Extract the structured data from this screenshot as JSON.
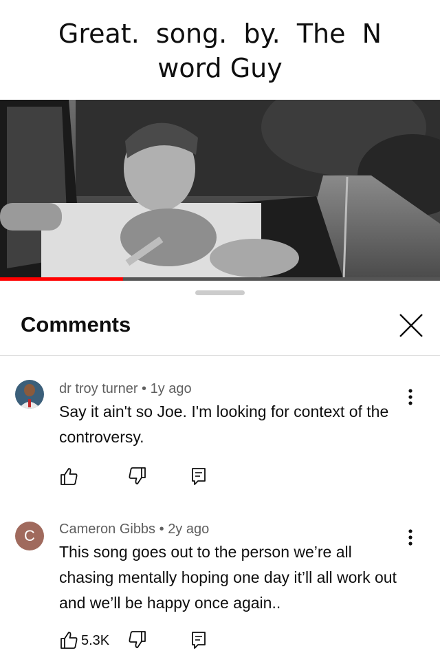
{
  "caption": {
    "line1": "Great.  song.  by.  The  N",
    "line2": "word Guy"
  },
  "video": {
    "progress": 0.28,
    "accent": "#ff0000"
  },
  "panel": {
    "title": "Comments"
  },
  "comments": [
    {
      "author": "dr troy turner",
      "age": "1y ago",
      "text": "Say it ain't so Joe. I'm looking for context of the controversy.",
      "likes": ""
    },
    {
      "author": "Cameron Gibbs",
      "age": "2y ago",
      "avatar_letter": "C",
      "text": "This song goes out to the person we’re all chasing mentally hoping one day it’ll all work out and we’ll be happy once again..",
      "likes": "5.3K"
    }
  ],
  "icons": [
    "close-icon",
    "more-vertical-icon",
    "thumbs-up-icon",
    "thumbs-down-icon",
    "reply-icon"
  ]
}
